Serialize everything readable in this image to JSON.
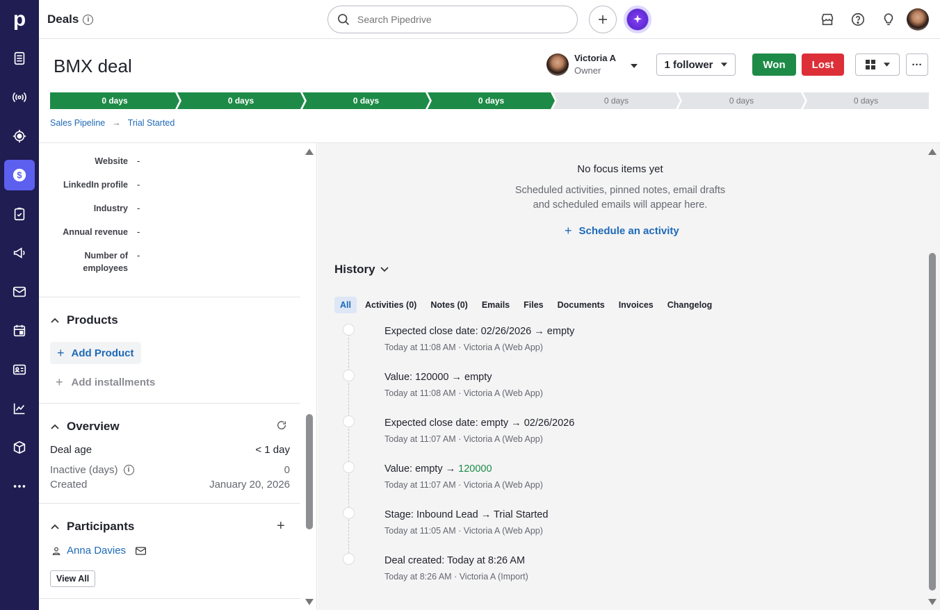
{
  "app": {
    "page_title": "Deals"
  },
  "search": {
    "placeholder": "Search Pipedrive"
  },
  "deal": {
    "title": "BMX deal",
    "owner_name": "Victoria A",
    "owner_role": "Owner",
    "follower_label": "1 follower",
    "won_label": "Won",
    "lost_label": "Lost",
    "more_label": "···"
  },
  "pipeline": {
    "stages": [
      {
        "label": "0 days",
        "done": true
      },
      {
        "label": "0 days",
        "done": true
      },
      {
        "label": "0 days",
        "done": true
      },
      {
        "label": "0 days",
        "done": true
      },
      {
        "label": "0 days",
        "done": false
      },
      {
        "label": "0 days",
        "done": false
      },
      {
        "label": "0 days",
        "done": false
      }
    ],
    "breadcrumb": [
      "Sales Pipeline",
      "Trial Started"
    ]
  },
  "details": {
    "fields": [
      {
        "label": "Website",
        "value": "-"
      },
      {
        "label": "LinkedIn profile",
        "value": "-"
      },
      {
        "label": "Industry",
        "value": "-"
      },
      {
        "label": "Annual revenue",
        "value": "-"
      },
      {
        "label": "Number of employees",
        "value": "-"
      }
    ]
  },
  "products": {
    "title": "Products",
    "add_product": "Add Product",
    "add_installments": "Add installments"
  },
  "overview": {
    "title": "Overview",
    "deal_age_label": "Deal age",
    "deal_age_value": "< 1 day",
    "inactive_label": "Inactive (days)",
    "inactive_value": "0",
    "created_label": "Created",
    "created_value": "January 20, 2026"
  },
  "participants": {
    "title": "Participants",
    "items": [
      "Anna Davies"
    ],
    "view_all": "View All"
  },
  "focus": {
    "title": "No focus items yet",
    "desc_line1": "Scheduled activities, pinned notes, email drafts",
    "desc_line2": "and scheduled emails will appear here.",
    "schedule_label": "Schedule an activity"
  },
  "history": {
    "title": "History",
    "tabs": [
      "All",
      "Activities (0)",
      "Notes (0)",
      "Emails",
      "Files",
      "Documents",
      "Invoices",
      "Changelog"
    ],
    "entries": [
      {
        "field": "Expected close date",
        "from": "02/26/2026",
        "to": "empty",
        "meta": "Today at 11:08 AM · Victoria A (Web App)"
      },
      {
        "field": "Value",
        "from": "120000",
        "to": "empty",
        "meta": "Today at 11:08 AM · Victoria A (Web App)"
      },
      {
        "field": "Expected close date",
        "from": "empty",
        "to": "02/26/2026",
        "meta": "Today at 11:07 AM · Victoria A (Web App)"
      },
      {
        "field": "Value",
        "from": "empty",
        "to": "120000",
        "meta": "Today at 11:07 AM · Victoria A (Web App)"
      },
      {
        "field": "Stage",
        "from": "Inbound Lead",
        "to": "Trial Started",
        "meta": "Today at 11:05 AM · Victoria A (Web App)"
      },
      {
        "field": "Deal created",
        "text": "Today at 8:26 AM",
        "meta": "Today at 8:26 AM · Victoria A (Import)"
      }
    ]
  },
  "colors": {
    "nav_bg": "#1f1d52",
    "accent": "#5d5fef",
    "won": "#1d8b47",
    "lost": "#dd2f37",
    "link": "#1e6ab7"
  }
}
